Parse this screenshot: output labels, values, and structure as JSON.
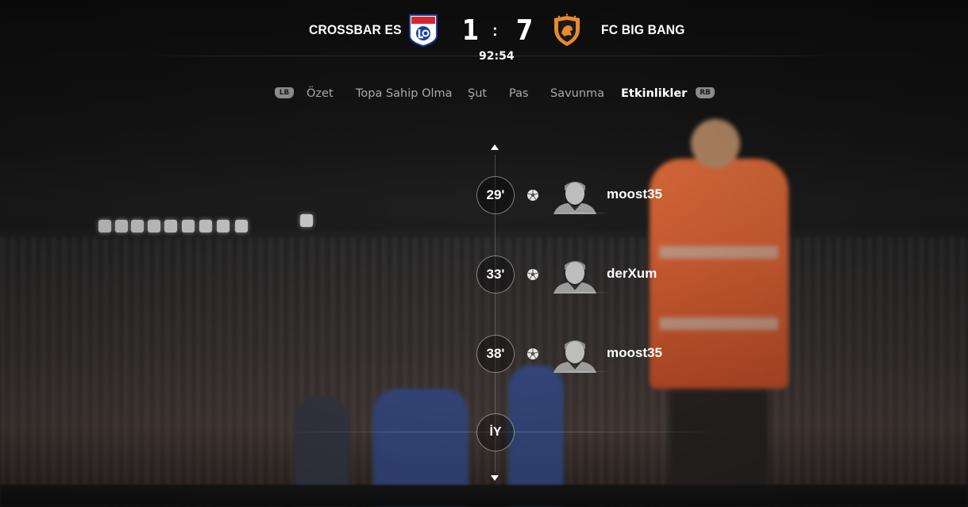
{
  "match": {
    "home_team": "CROSSBAR ES",
    "away_team": "FC BIG BANG",
    "home_score": "1",
    "away_score": "7",
    "separator": ":",
    "clock": "92:54",
    "home_crest_icon": "olympique-lyonnais-crest",
    "away_crest_icon": "orange-lion-shield-crest"
  },
  "tabs": {
    "left_bumper": "LB",
    "right_bumper": "RB",
    "items": [
      {
        "label": "Özet",
        "active": false
      },
      {
        "label": "Topa Sahip Olma",
        "active": false
      },
      {
        "label": "Şut",
        "active": false
      },
      {
        "label": "Pas",
        "active": false
      },
      {
        "label": "Savunma",
        "active": false
      },
      {
        "label": "Etkinlikler",
        "active": true
      }
    ]
  },
  "timeline": {
    "events": [
      {
        "minute": "29'",
        "type_icon": "soccer-ball-icon",
        "player": "moost35"
      },
      {
        "minute": "33'",
        "type_icon": "soccer-ball-icon",
        "player": "derXum"
      },
      {
        "minute": "38'",
        "type_icon": "soccer-ball-icon",
        "player": "moost35"
      }
    ],
    "half_time_label": "İY"
  },
  "colors": {
    "active_tab": "#ffffff",
    "inactive_tab": "#a9a9a9",
    "away_crest": "#e88a2e",
    "home_crest_blue": "#1a3f9e",
    "home_crest_red": "#d6262d"
  }
}
